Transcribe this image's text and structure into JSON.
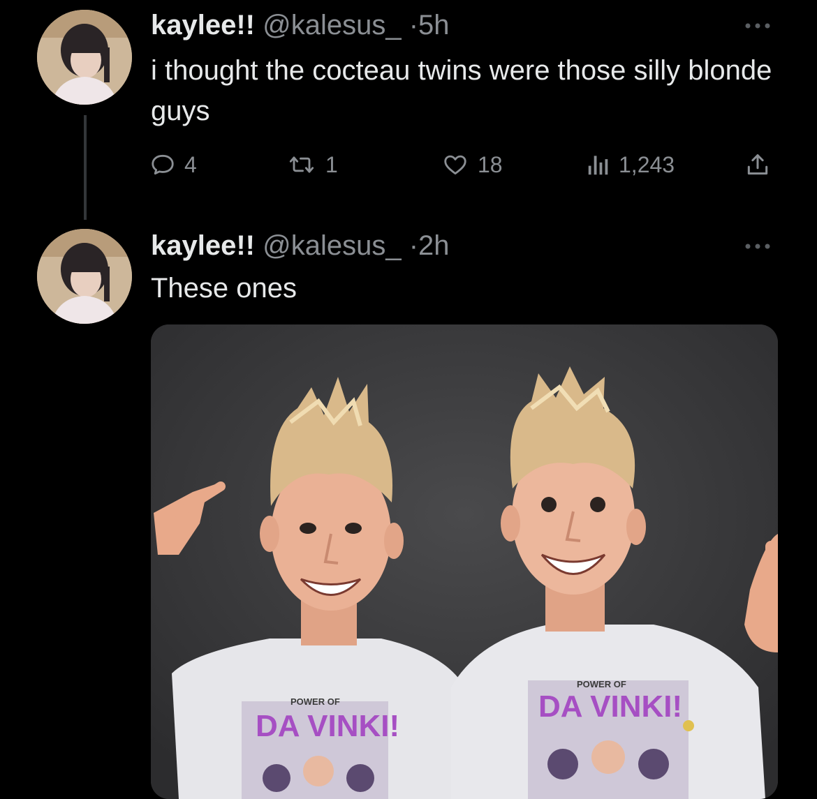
{
  "tweets": [
    {
      "display_name": "kaylee!!",
      "handle": "@kalesus_",
      "separator": "·",
      "time": "5h",
      "text": "i thought the cocteau twins were those silly blonde guys",
      "actions": {
        "replies": "4",
        "retweets": "1",
        "likes": "18",
        "views": "1,243"
      }
    },
    {
      "display_name": "kaylee!!",
      "handle": "@kalesus_",
      "separator": "·",
      "time": "2h",
      "text": "These ones",
      "media": {
        "shirt_text_top": "POWER OF",
        "shirt_text_main": "DA VINKI!"
      }
    }
  ],
  "colors": {
    "background": "#000000",
    "primary_text": "#e7e9ea",
    "secondary_text": "#8b8f94",
    "thread_line": "#333639"
  }
}
